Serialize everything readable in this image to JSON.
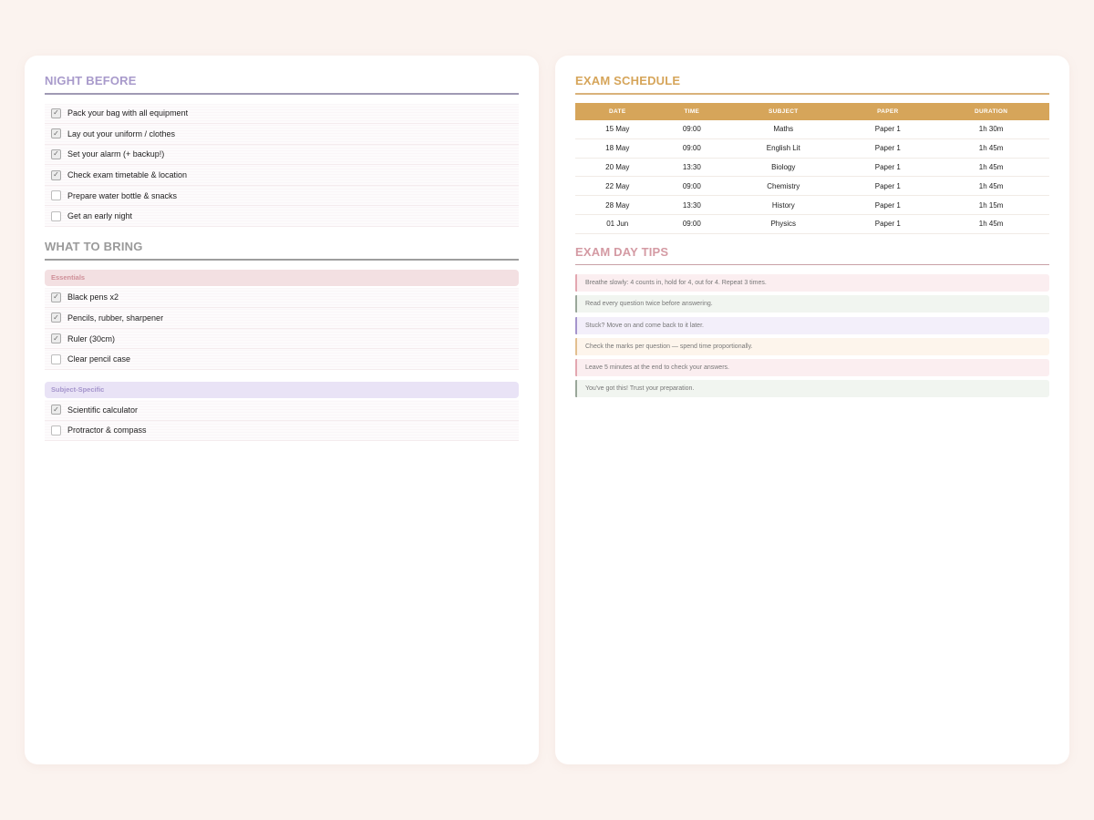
{
  "night_before": {
    "title": "NIGHT BEFORE",
    "color": "#a89acb",
    "items": [
      {
        "label": "Pack your bag with all equipment",
        "checked": true
      },
      {
        "label": "Lay out your uniform / clothes",
        "checked": true
      },
      {
        "label": "Set your alarm (+ backup!)",
        "checked": true
      },
      {
        "label": "Check exam timetable & location",
        "checked": true
      },
      {
        "label": "Prepare water bottle & snacks",
        "checked": false
      },
      {
        "label": "Get an early night",
        "checked": false
      }
    ]
  },
  "what_to_bring": {
    "title": "WHAT TO BRING",
    "color": "#9a9a9a",
    "groups": [
      {
        "name": "Essentials",
        "bg": "#f3e0e2",
        "fg": "#cf8f98",
        "items": [
          {
            "label": "Black pens x2",
            "checked": true
          },
          {
            "label": "Pencils, rubber, sharpener",
            "checked": true
          },
          {
            "label": "Ruler (30cm)",
            "checked": true
          },
          {
            "label": "Clear pencil case",
            "checked": false
          }
        ]
      },
      {
        "name": "Subject-Specific",
        "bg": "#e9e3f6",
        "fg": "#a595cc",
        "items": [
          {
            "label": "Scientific calculator",
            "checked": true
          },
          {
            "label": "Protractor & compass",
            "checked": false
          }
        ]
      }
    ]
  },
  "exam_schedule": {
    "title": "EXAM SCHEDULE",
    "color": "#d6a55a",
    "columns": [
      "DATE",
      "TIME",
      "SUBJECT",
      "PAPER",
      "DURATION"
    ],
    "rows": [
      [
        "15 May",
        "09:00",
        "Maths",
        "Paper 1",
        "1h 30m"
      ],
      [
        "18 May",
        "09:00",
        "English Lit",
        "Paper 1",
        "1h 45m"
      ],
      [
        "20 May",
        "13:30",
        "Biology",
        "Paper 1",
        "1h 45m"
      ],
      [
        "22 May",
        "09:00",
        "Chemistry",
        "Paper 1",
        "1h 45m"
      ],
      [
        "28 May",
        "13:30",
        "History",
        "Paper 1",
        "1h 15m"
      ],
      [
        "01 Jun",
        "09:00",
        "Physics",
        "Paper 1",
        "1h 45m"
      ]
    ]
  },
  "exam_day_tips": {
    "title": "EXAM DAY TIPS",
    "color": "#d49aa3",
    "tips": [
      {
        "text": "Breathe slowly: 4 counts in, hold for 4, out for 4. Repeat 3 times.",
        "bg": "#fbeef0",
        "border": "#e3a7b0"
      },
      {
        "text": "Read every question twice before answering.",
        "bg": "#f1f5f0",
        "border": "#9aa79a"
      },
      {
        "text": "Stuck? Move on and come back to it later.",
        "bg": "#f3effa",
        "border": "#a595cc"
      },
      {
        "text": "Check the marks per question — spend time proportionally.",
        "bg": "#fdf5ec",
        "border": "#e2bf8f"
      },
      {
        "text": "Leave 5 minutes at the end to check your answers.",
        "bg": "#fbeef0",
        "border": "#e3a7b0"
      },
      {
        "text": "You've got this! Trust your preparation.",
        "bg": "#f1f5f0",
        "border": "#9aa79a"
      }
    ]
  }
}
